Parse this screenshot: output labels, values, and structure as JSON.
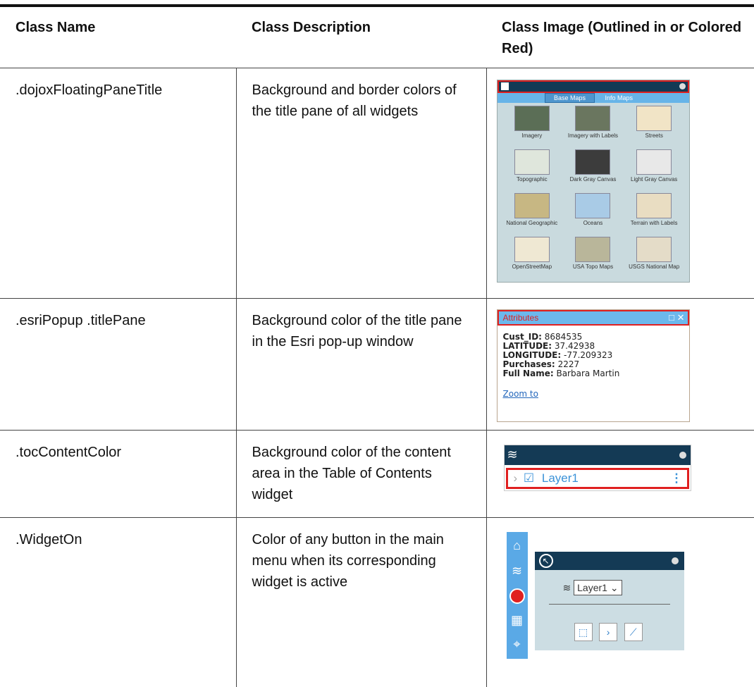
{
  "table": {
    "headers": [
      "Class Name",
      "Class Description",
      "Class Image (Outlined in or Colored Red)"
    ],
    "rows": [
      {
        "name": ".dojoxFloatingPaneTitle",
        "description": "Background and border colors of the title pane of all widgets"
      },
      {
        "name": ".esriPopup .titlePane",
        "description": "Background color of the title pane in the Esri pop-up window"
      },
      {
        "name": ".tocContentColor",
        "description": "Background color of the content area in the Table of Contents widget"
      },
      {
        "name": ".WidgetOn",
        "description": "Color of any button in the main menu when its corresponding widget is active"
      }
    ]
  },
  "basemap_widget": {
    "tabs": [
      "Base Maps",
      "Info Maps"
    ],
    "items": [
      "Imagery",
      "Imagery with Labels",
      "Streets",
      "Topographic",
      "Dark Gray Canvas",
      "Light Gray Canvas",
      "National Geographic",
      "Oceans",
      "Terrain with Labels",
      "OpenStreetMap",
      "USA Topo Maps",
      "USGS National Map"
    ]
  },
  "popup": {
    "title": "Attributes",
    "controls": "□ ✕",
    "fields": [
      {
        "label": "Cust_ID:",
        "value": "8684535"
      },
      {
        "label": "LATITUDE:",
        "value": "37.42938"
      },
      {
        "label": "LONGITUDE:",
        "value": "-77.209323"
      },
      {
        "label": "Purchases:",
        "value": "2227"
      },
      {
        "label": "Full Name:",
        "value": "Barbara Martin"
      }
    ],
    "link": "Zoom to"
  },
  "toc": {
    "layer": "Layer1"
  },
  "widget_on": {
    "select_value": "Layer1"
  },
  "colors": {
    "highlight": "#e02020",
    "title_pane": "#143a55",
    "accent_blue": "#5aa9e6"
  }
}
